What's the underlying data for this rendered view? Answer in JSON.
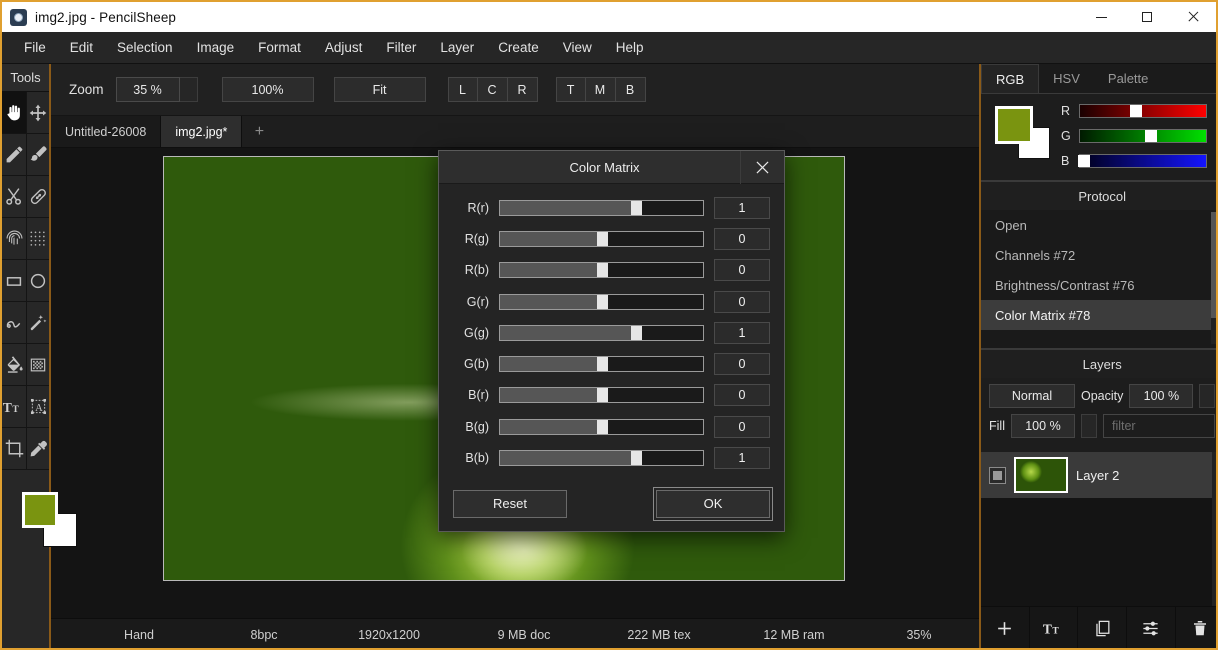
{
  "window": {
    "title": "img2.jpg - PencilSheep",
    "icon": "app-icon",
    "minimize": "−",
    "maximize": "□",
    "close": "×"
  },
  "menubar": {
    "items": [
      "File",
      "Edit",
      "Selection",
      "Image",
      "Format",
      "Adjust",
      "Filter",
      "Layer",
      "Create",
      "View",
      "Help"
    ]
  },
  "tools": {
    "header": "Tools",
    "items": [
      {
        "name": "hand-tool",
        "icon": "hand-icon",
        "active": true
      },
      {
        "name": "move-tool",
        "icon": "move-icon",
        "active": false
      },
      {
        "name": "pencil-tool",
        "icon": "pencil-icon",
        "active": false
      },
      {
        "name": "brush-tool",
        "icon": "brush-icon",
        "active": false
      },
      {
        "name": "scissors-tool",
        "icon": "scissors-icon",
        "active": false
      },
      {
        "name": "heal-tool",
        "icon": "bandage-icon",
        "active": false
      },
      {
        "name": "smudge-tool",
        "icon": "fingerprint-icon",
        "active": false
      },
      {
        "name": "dither-tool",
        "icon": "dots-grid-icon",
        "active": false
      },
      {
        "name": "rectangle-tool",
        "icon": "rectangle-icon",
        "active": false
      },
      {
        "name": "ellipse-tool",
        "icon": "circle-icon",
        "active": false
      },
      {
        "name": "curve-tool",
        "icon": "squiggle-icon",
        "active": false
      },
      {
        "name": "magic-wand-tool",
        "icon": "wand-icon",
        "active": false
      },
      {
        "name": "fill-tool",
        "icon": "paint-bucket-icon",
        "active": false
      },
      {
        "name": "gradient-tool",
        "icon": "checkerboard-icon",
        "active": false
      },
      {
        "name": "text-tool",
        "icon": "text-Tt-icon",
        "active": false
      },
      {
        "name": "text-box-tool",
        "icon": "text-frame-icon",
        "active": false
      },
      {
        "name": "crop-tool",
        "icon": "crop-icon",
        "active": false
      },
      {
        "name": "eyedropper-tool",
        "icon": "eyedropper-icon",
        "active": false
      }
    ],
    "foreground_color": "#7a9410",
    "background_color": "#ffffff"
  },
  "zoombar": {
    "zoom_label": "Zoom",
    "zoom_value": "35 %",
    "btn_100": "100%",
    "btn_fit": "Fit",
    "align_h": [
      "L",
      "C",
      "R"
    ],
    "align_v": [
      "T",
      "M",
      "B"
    ]
  },
  "tabs": {
    "items": [
      {
        "label": "Untitled-26008",
        "active": false
      },
      {
        "label": "img2.jpg*",
        "active": true
      }
    ],
    "add": "+"
  },
  "statusbar": {
    "cells": [
      "Hand",
      "8bpc",
      "1920x1200",
      "9 MB doc",
      "222 MB tex",
      "12 MB ram",
      "35%"
    ]
  },
  "right_panel": {
    "tabs": [
      {
        "label": "RGB",
        "active": true
      },
      {
        "label": "HSV",
        "active": false
      },
      {
        "label": "Palette",
        "active": false
      }
    ],
    "channels": [
      {
        "label": "R",
        "value_pct": 44,
        "color": "#ff0000"
      },
      {
        "label": "G",
        "value_pct": 56,
        "color": "#00e000"
      },
      {
        "label": "B",
        "value_pct": 3,
        "color": "#1414ff"
      }
    ],
    "protocol": {
      "header": "Protocol",
      "items": [
        {
          "label": "Open",
          "selected": false
        },
        {
          "label": "Channels  #72",
          "selected": false
        },
        {
          "label": "Brightness/Contrast  #76",
          "selected": false
        },
        {
          "label": "Color Matrix  #78",
          "selected": true
        }
      ]
    },
    "layers": {
      "header": "Layers",
      "blend_mode": "Normal",
      "opacity_label": "Opacity",
      "opacity_value": "100 %",
      "fill_label": "Fill",
      "fill_value": "100 %",
      "filter_placeholder": "filter",
      "rows": [
        {
          "name": "Layer 2",
          "visible": true
        }
      ],
      "toolbar": [
        {
          "name": "add-layer-button",
          "icon": "plus-icon"
        },
        {
          "name": "add-text-layer-button",
          "icon": "text-Tt-icon"
        },
        {
          "name": "duplicate-layer-button",
          "icon": "copy-icon"
        },
        {
          "name": "layer-properties-button",
          "icon": "sliders-icon"
        },
        {
          "name": "delete-layer-button",
          "icon": "trash-icon"
        }
      ]
    }
  },
  "dialog": {
    "title": "Color Matrix",
    "close": "×",
    "sliders": [
      {
        "label": "R(r)",
        "value": "1",
        "pos_pct": 67
      },
      {
        "label": "R(g)",
        "value": "0",
        "pos_pct": 50
      },
      {
        "label": "R(b)",
        "value": "0",
        "pos_pct": 50
      },
      {
        "label": "G(r)",
        "value": "0",
        "pos_pct": 50
      },
      {
        "label": "G(g)",
        "value": "1",
        "pos_pct": 67
      },
      {
        "label": "G(b)",
        "value": "0",
        "pos_pct": 50
      },
      {
        "label": "B(r)",
        "value": "0",
        "pos_pct": 50
      },
      {
        "label": "B(g)",
        "value": "0",
        "pos_pct": 50
      },
      {
        "label": "B(b)",
        "value": "1",
        "pos_pct": 67
      }
    ],
    "reset_label": "Reset",
    "ok_label": "OK"
  }
}
